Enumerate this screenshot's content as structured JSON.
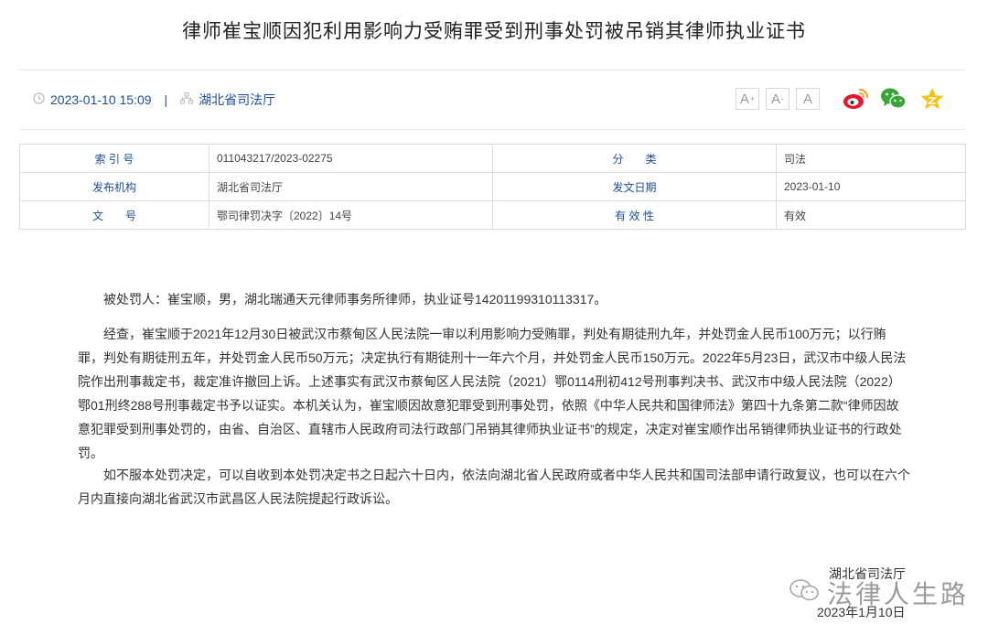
{
  "article": {
    "title": "律师崔宝顺因犯利用影响力受贿罪受到刑事处罚被吊销其律师执业证书",
    "datetime": "2023-01-10 15:09",
    "separator": "|",
    "source": "湖北省司法厅"
  },
  "toolbar": {
    "font_large": "A",
    "font_large_sup": "+",
    "font_small": "A",
    "font_small_sup": "-",
    "font_normal": "A"
  },
  "icons": {
    "clock": "clock-icon",
    "org": "org-chart-icon",
    "weibo": "weibo-icon",
    "wechat": "wechat-icon",
    "favorite": "star-icon"
  },
  "info_table": {
    "rows": [
      {
        "label1": "索 引 号",
        "value1": "011043217/2023-02275",
        "label2": "分　　类",
        "value2": "司法"
      },
      {
        "label1": "发布机构",
        "value1": "湖北省司法厅",
        "label2": "发文日期",
        "value2": "2023-01-10"
      },
      {
        "label1": "文　　号",
        "value1": "鄂司律罚决字〔2022〕14号",
        "label2": "有 效 性",
        "value2": "有效"
      }
    ]
  },
  "body": {
    "p1": "被处罚人：崔宝顺，男，湖北瑞通天元律师事务所律师，执业证号14201199310113317。",
    "p2": "经查，崔宝顺于2021年12月30日被武汉市蔡甸区人民法院一审以利用影响力受贿罪，判处有期徒刑九年，并处罚金人民币100万元；以行贿罪，判处有期徒刑五年，并处罚金人民币50万元；决定执行有期徒刑十一年六个月，并处罚金人民币150万元。2022年5月23日，武汉市中级人民法院作出刑事裁定书，裁定准许撤回上诉。上述事实有武汉市蔡甸区人民法院（2021）鄂0114刑初412号刑事判决书、武汉市中级人民法院（2022）鄂01刑终288号刑事裁定书予以证实。本机关认为，崔宝顺因故意犯罪受到刑事处罚，依照《中华人民共和国律师法》第四十九条第二款“律师因故意犯罪受到刑事处罚的，由省、自治区、直辖市人民政府司法行政部门吊销其律师执业证书”的规定，决定对崔宝顺作出吊销律师执业证书的行政处罚。",
    "p3": "如不服本处罚决定，可以自收到本处罚决定书之日起六十日内，依法向湖北省人民政府或者中华人民共和国司法部申请行政复议，也可以在六个月内直接向湖北省武汉市武昌区人民法院提起行政诉讼。"
  },
  "signature": {
    "org": "湖北省司法厅",
    "date": "2023年1月10日"
  },
  "watermark": {
    "text": "法律人生路"
  },
  "colors": {
    "link_blue": "#1b4e9a",
    "weibo_red": "#e6162d",
    "weibo_orange": "#f5a623",
    "wechat_green": "#3aa537",
    "star_yellow": "#f4c20d"
  }
}
